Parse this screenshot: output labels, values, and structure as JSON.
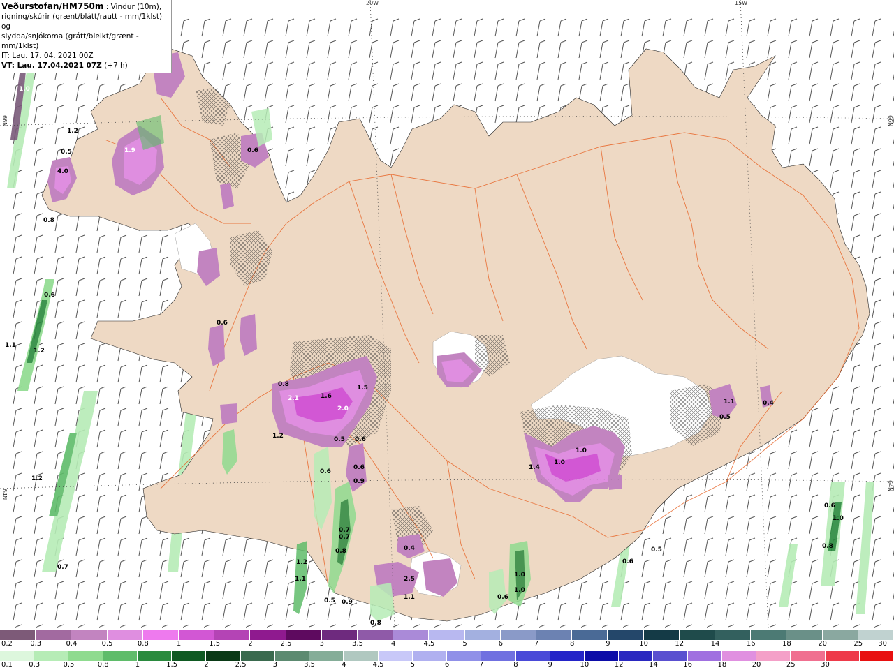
{
  "info": {
    "title": "Veðurstofan/HM750m",
    "desc_line1": " : Vindur (10m),",
    "desc_line2": "rigning/skúrir (grænt/blátt/rautt - mm/1klst) og",
    "desc_line3": "slydda/snjókoma (grátt/bleikt/grænt - mm/1klst)",
    "it": "IT: Lau. 17. 04. 2021 00Z",
    "vt": "VT: Lau. 17.04.2021 07Z",
    "vt_lead": " (+7 h)"
  },
  "graticule": {
    "lon_labels": [
      "20W",
      "15W"
    ],
    "lat_labels": [
      "66N",
      "64N"
    ]
  },
  "colors": {
    "land": "#eed9c4",
    "glacier": "#ffffff",
    "roads": "#e8662a",
    "rivers": "#ef8a5a"
  },
  "precip_labels": [
    {
      "t": "1.0"
    },
    {
      "t": "1.2"
    },
    {
      "t": "0.5"
    },
    {
      "t": "4.0"
    },
    {
      "t": "1.9"
    },
    {
      "t": "0.6"
    },
    {
      "t": "0.8"
    },
    {
      "t": "0.6"
    },
    {
      "t": "1.1"
    },
    {
      "t": "1.2"
    },
    {
      "t": "1.2"
    },
    {
      "t": "0.7"
    },
    {
      "t": "0.6"
    },
    {
      "t": "0.8"
    },
    {
      "t": "2.1"
    },
    {
      "t": "1.6"
    },
    {
      "t": "2.0"
    },
    {
      "t": "1.5"
    },
    {
      "t": "1.2"
    },
    {
      "t": "0.5"
    },
    {
      "t": "0.6"
    },
    {
      "t": "0.9"
    },
    {
      "t": "0.6"
    },
    {
      "t": "0.6"
    },
    {
      "t": "0.7"
    },
    {
      "t": "0.7"
    },
    {
      "t": "0.8"
    },
    {
      "t": "1.2"
    },
    {
      "t": "1.1"
    },
    {
      "t": "0.5"
    },
    {
      "t": "0.9"
    },
    {
      "t": "0.8"
    },
    {
      "t": "0.4"
    },
    {
      "t": "2.5"
    },
    {
      "t": "1.1"
    },
    {
      "t": "1.0"
    },
    {
      "t": "1.0"
    },
    {
      "t": "0.6"
    },
    {
      "t": "1.4"
    },
    {
      "t": "1.0"
    },
    {
      "t": "1.0"
    },
    {
      "t": "0.6"
    },
    {
      "t": "0.5"
    },
    {
      "t": "0.6"
    },
    {
      "t": "1.0"
    },
    {
      "t": "0.8"
    },
    {
      "t": "1.1"
    },
    {
      "t": "0.5"
    },
    {
      "t": "0.4"
    }
  ],
  "legend_snow": {
    "labels": [
      "0.2",
      "0.3",
      "0.4",
      "0.5",
      "0.8",
      "1",
      "1.5",
      "2",
      "2.5",
      "3",
      "3.5",
      "4",
      "4.5",
      "5",
      "6",
      "7",
      "8",
      "9",
      "10",
      "12",
      "14",
      "16",
      "18",
      "20",
      "25",
      "30"
    ],
    "colors": [
      "#7d5a78",
      "#a26aa0",
      "#c284c0",
      "#df8ee0",
      "#ee7aee",
      "#d257d4",
      "#b444b5",
      "#8f1a8f",
      "#5e0a5f",
      "#6e2a7e",
      "#8f5aa8",
      "#aa8ad8",
      "#b8b8f0",
      "#a3b0e0",
      "#8a9ac8",
      "#6c82b2",
      "#4a6a96",
      "#24476a",
      "#143a46",
      "#1f4b4b",
      "#33605e",
      "#4c7a74",
      "#6a9088",
      "#8aa8a0",
      "#c0d2d0"
    ]
  },
  "legend_rain": {
    "labels": [
      "0.1",
      "0.3",
      "0.5",
      "0.8",
      "1",
      "1.5",
      "2",
      "2.5",
      "3",
      "3.5",
      "4",
      "4.5",
      "5",
      "6",
      "7",
      "8",
      "9",
      "10",
      "12",
      "14",
      "16",
      "18",
      "20",
      "25",
      "30"
    ],
    "colors": [
      "#ddf7dd",
      "#b6ecb6",
      "#8fdb8f",
      "#5fbc6a",
      "#2a8a3e",
      "#0f5a22",
      "#0a3a16",
      "#3a6a4e",
      "#5c8a70",
      "#85ad98",
      "#b0c8c0",
      "#c8c8f8",
      "#b0b0f0",
      "#9090e8",
      "#7070e0",
      "#4a4ad8",
      "#2424c8",
      "#0c0ca8",
      "#2a28c0",
      "#5a50d0",
      "#a070e0",
      "#e090e0",
      "#f4a0c8",
      "#f07090",
      "#ee3a4a",
      "#e81010"
    ]
  }
}
